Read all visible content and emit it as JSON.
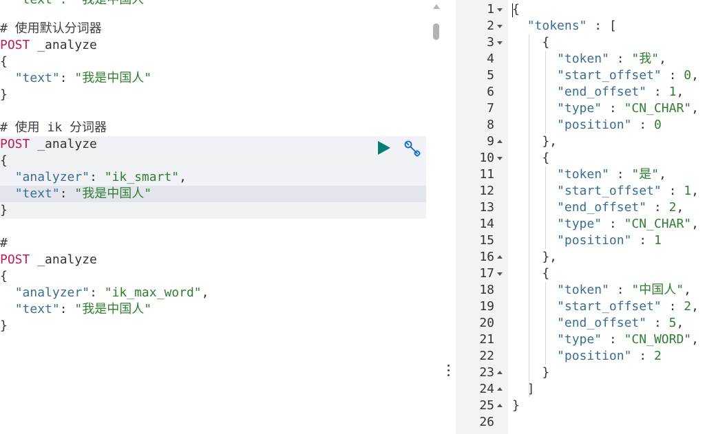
{
  "request_editor": {
    "top_clipped_line": "  \"text\": \"我是中国人\"",
    "block1": {
      "comment": "# 使用默认分词器",
      "method": "POST",
      "path": " _analyze",
      "open": "{",
      "text_key": "\"text\"",
      "text_value": "\"我是中国人\"",
      "close": "}"
    },
    "block2": {
      "comment": "# 使用 ik 分词器",
      "method": "POST",
      "path": " _analyze",
      "open": "{",
      "analyzer_key": "\"analyzer\"",
      "analyzer_value": "\"ik_smart\"",
      "text_key": "\"text\"",
      "text_value": "\"我是中国人\"",
      "close": "}"
    },
    "block3": {
      "comment": "#",
      "method": "POST",
      "path": " _analyze",
      "open": "{",
      "analyzer_key": "\"analyzer\"",
      "analyzer_value": "\"ik_max_word\"",
      "text_key": "\"text\"",
      "text_value": "\"我是中国人\"",
      "close": "}"
    },
    "actions": {
      "run_icon": "play-triangle-icon",
      "settings_icon": "wrench-icon",
      "accent_color": "#017d73"
    }
  },
  "response_viewer": {
    "line_numbers": [
      "1",
      "2",
      "3",
      "4",
      "5",
      "6",
      "7",
      "8",
      "9",
      "10",
      "11",
      "12",
      "13",
      "14",
      "15",
      "16",
      "17",
      "18",
      "19",
      "20",
      "21",
      "22",
      "23",
      "24",
      "25",
      "26"
    ],
    "lines": [
      "{",
      "  \"tokens\" : [",
      "    {",
      "      \"token\" : \"我\",",
      "      \"start_offset\" : 0,",
      "      \"end_offset\" : 1,",
      "      \"type\" : \"CN_CHAR\",",
      "      \"position\" : 0",
      "    },",
      "    {",
      "      \"token\" : \"是\",",
      "      \"start_offset\" : 1,",
      "      \"end_offset\" : 2,",
      "      \"type\" : \"CN_CHAR\",",
      "      \"position\" : 1",
      "    },",
      "    {",
      "      \"token\" : \"中国人\",",
      "      \"start_offset\" : 2,",
      "      \"end_offset\" : 5,",
      "      \"type\" : \"CN_WORD\",",
      "      \"position\" : 2",
      "    }",
      "  ]",
      "}",
      ""
    ]
  }
}
